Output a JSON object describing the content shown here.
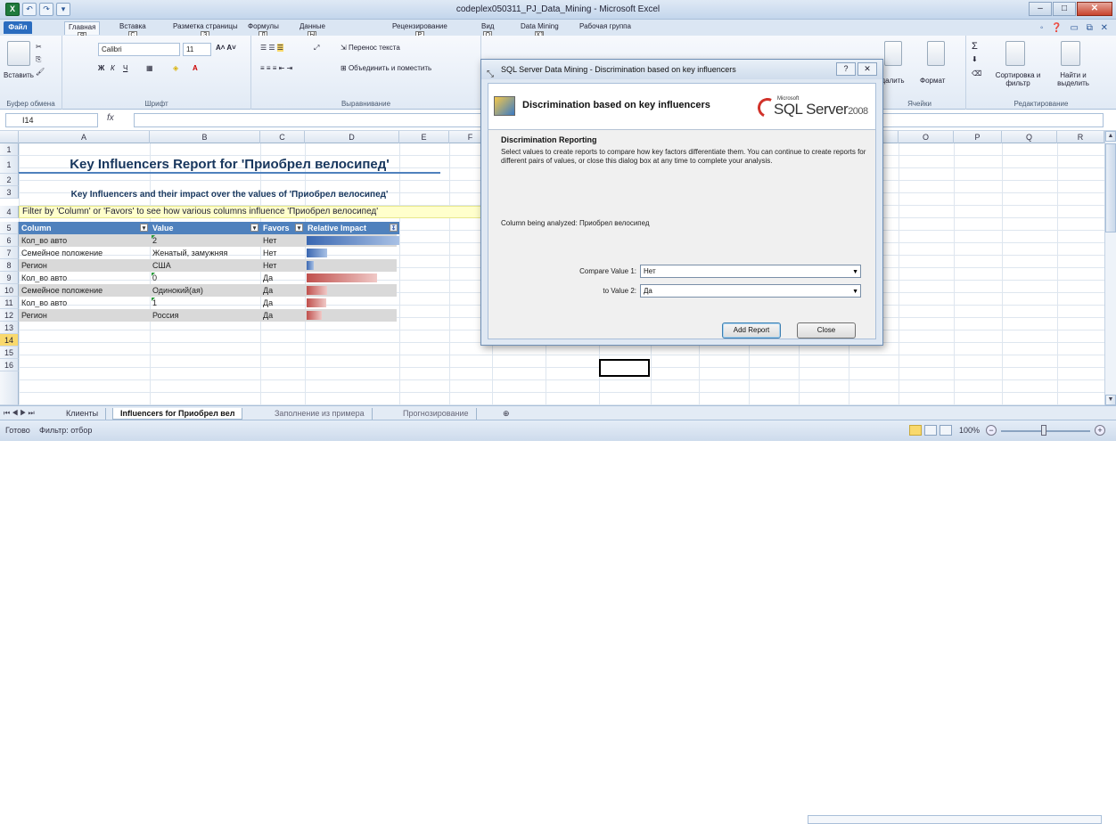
{
  "window": {
    "title": "codeplex050311_PJ_Data_Mining - Microsoft Excel",
    "controls": [
      "–",
      "□",
      "✕"
    ]
  },
  "qat": [
    "X",
    "↶",
    "↷",
    "▾"
  ],
  "ribbon_tabs": [
    {
      "label": "Файл",
      "key": "F"
    },
    {
      "label": "Главная",
      "key": "Я"
    },
    {
      "label": "Вставка",
      "key": "С"
    },
    {
      "label": "Разметка страницы",
      "key": "З"
    },
    {
      "label": "Формулы",
      "key": "Л"
    },
    {
      "label": "Данные",
      "key": "Ы"
    },
    {
      "label": "Рецензирование",
      "key": "Р"
    },
    {
      "label": "Вид",
      "key": "О"
    },
    {
      "label": "Data Mining",
      "key": "X1"
    },
    {
      "label": "Рабочая группа",
      "key": ""
    }
  ],
  "ribbon": {
    "paste": "Вставить",
    "clipboard_group": "Буфер обмена",
    "font_name": "Calibri",
    "font_size": "11",
    "font_group": "Шрифт",
    "wrap_text": "Перенос текста",
    "merge": "Объединить и поместить",
    "align_group": "Выравнивание",
    "delete": "Удалить",
    "format": "Формат",
    "cells_group": "Ячейки",
    "sort": "Сортировка и фильтр",
    "find": "Найти и выделить",
    "edit_group": "Редактирование"
  },
  "formula_bar": {
    "name_box": "I14",
    "fx": "fx",
    "value": ""
  },
  "columns": [
    "A",
    "B",
    "C",
    "D",
    "E",
    "F",
    "G",
    "H",
    "I",
    "J",
    "K",
    "L",
    "M",
    "N",
    "O",
    "P",
    "Q",
    "R"
  ],
  "rows": [
    "1",
    "2",
    "3",
    "4",
    "5",
    "6",
    "7",
    "8",
    "9",
    "10",
    "11",
    "12",
    "13",
    "14",
    "15",
    "16"
  ],
  "sheet": {
    "title": "Key Influencers Report for 'Приобрел велосипед'",
    "subtitle": "Key Influencers and their impact over the values of 'Приобрел велосипед'",
    "filter_note": "Filter by 'Column' or 'Favors' to see how various columns influence 'Приобрел велосипед'",
    "headers": [
      "Column",
      "Value",
      "Favors",
      "Relative Impact"
    ],
    "table": [
      {
        "column": "Кол_во авто",
        "value": "2",
        "favors": "Нет",
        "impact": 1.0,
        "color": "#3a67b1"
      },
      {
        "column": "Семейное положение",
        "value": "Женатый, замужняя",
        "favors": "Нет",
        "impact": 0.22,
        "color": "#3a67b1"
      },
      {
        "column": "Регион",
        "value": "США",
        "favors": "Нет",
        "impact": 0.08,
        "color": "#3a67b1"
      },
      {
        "column": "Кол_во авто",
        "value": "0",
        "favors": "Да",
        "impact": 0.76,
        "color": "#c0504d"
      },
      {
        "column": "Семейное положение",
        "value": "Одинокий(ая)",
        "favors": "Да",
        "impact": 0.22,
        "color": "#c0504d"
      },
      {
        "column": "Кол_во авто",
        "value": "1",
        "favors": "Да",
        "impact": 0.21,
        "color": "#c0504d"
      },
      {
        "column": "Регион",
        "value": "Россия",
        "favors": "Да",
        "impact": 0.16,
        "color": "#c0504d"
      }
    ]
  },
  "sheet_tabs": [
    "Клиенты",
    "Influencers for Приобрел вел",
    "Заполнение из примера",
    "Прогнозирование"
  ],
  "statusbar": {
    "ready": "Готово",
    "filter": "Фильтр: отбор",
    "zoom": "100%"
  },
  "dialog": {
    "title": "SQL Server Data Mining - Discrimination based on key influencers",
    "header": "Discrimination based on key influencers",
    "brand_micro": "Microsoft",
    "brand": "SQL Server",
    "brand_year": "2008",
    "section": "Discrimination Reporting",
    "description": "Select values to create reports to compare how key factors differentiate them. You can continue to create reports for different pairs of values, or close this dialog box at any time to complete your analysis.",
    "analyzed": "Column being analyzed: Приобрел велосипед",
    "compare_label": "Compare Value 1:",
    "compare_value": "Нет",
    "to_label": "to Value 2:",
    "to_value": "Да",
    "add_report": "Add Report",
    "close": "Close"
  }
}
